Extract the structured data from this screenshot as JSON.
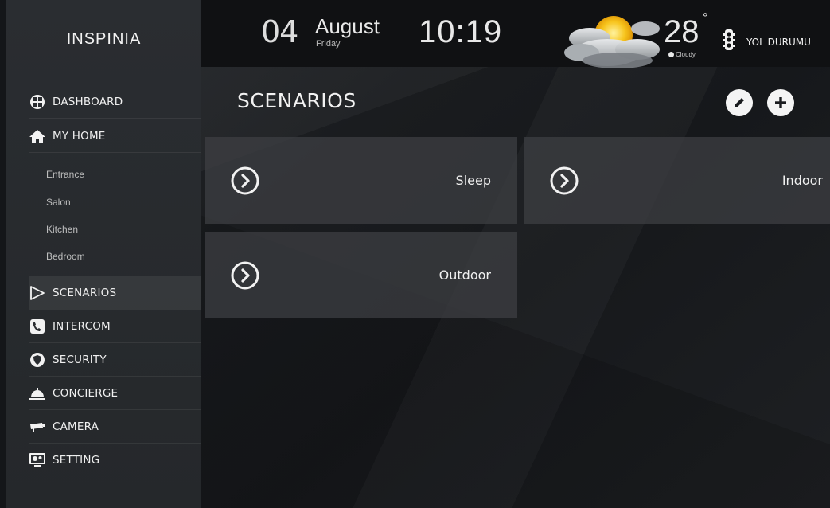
{
  "brand": {
    "logo_text": "INSPINIA"
  },
  "header": {
    "day": "04",
    "month": "August",
    "weekday": "Friday",
    "time": "10:19",
    "temperature": "28",
    "degree_symbol": "°",
    "condition": "Cloudy",
    "traffic_label": "YOL DURUMU"
  },
  "sidebar": {
    "items": [
      {
        "label": "DASHBOARD",
        "icon": "dashboard-icon"
      },
      {
        "label": "MY HOME",
        "icon": "home-icon"
      },
      {
        "label": "SCENARIOS",
        "icon": "play-icon",
        "active": true
      },
      {
        "label": "INTERCOM",
        "icon": "phone-icon"
      },
      {
        "label": "SECURITY",
        "icon": "shield-icon"
      },
      {
        "label": "CONCIERGE",
        "icon": "cloche-icon"
      },
      {
        "label": "CAMERA",
        "icon": "camera-icon"
      },
      {
        "label": "SETTING",
        "icon": "settings-icon"
      }
    ],
    "rooms": [
      "Entrance",
      "Salon",
      "Kitchen",
      "Bedroom"
    ]
  },
  "main": {
    "title": "SCENARIOS",
    "scenarios": [
      {
        "label": "Sleep"
      },
      {
        "label": "Indoor"
      },
      {
        "label": "Outdoor"
      }
    ]
  },
  "colors": {
    "background": "#141619",
    "sidebar": "#2a2d31",
    "card": "#3e4044",
    "text": "#ffffff"
  }
}
